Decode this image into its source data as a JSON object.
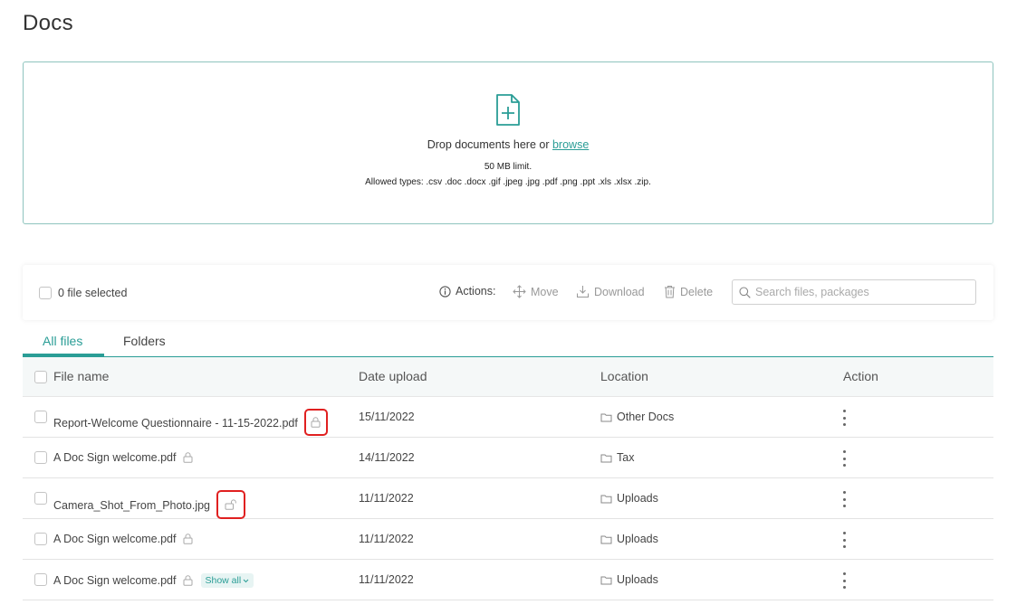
{
  "page": {
    "title": "Docs"
  },
  "dropzone": {
    "text": "Drop documents here or",
    "browse_label": "browse",
    "limit": "50 MB limit.",
    "allowed": "Allowed types: .csv .doc .docx .gif .jpeg .jpg .pdf .png .ppt .xls .xlsx .zip.",
    "icon": "file-add-icon"
  },
  "toolbar": {
    "selected_label": "0 file selected",
    "actions_label": "Actions:",
    "move_label": "Move",
    "download_label": "Download",
    "delete_label": "Delete",
    "search_placeholder": "Search files, packages"
  },
  "tabs": [
    {
      "label": "All files",
      "active": true
    },
    {
      "label": "Folders",
      "active": false
    }
  ],
  "table": {
    "headers": {
      "name": "File name",
      "date": "Date upload",
      "location": "Location",
      "action": "Action"
    },
    "rows": [
      {
        "name": "Report-Welcome Questionnaire - 11-15-2022.pdf",
        "date": "15/11/2022",
        "location": "Other Docs",
        "lock": "locked-highlighted"
      },
      {
        "name": "A Doc Sign welcome.pdf",
        "date": "14/11/2022",
        "location": "Tax",
        "lock": "locked"
      },
      {
        "name": "Camera_Shot_From_Photo.jpg",
        "date": "11/11/2022",
        "location": "Uploads",
        "lock": "unlocked-highlighted"
      },
      {
        "name": "A Doc Sign welcome.pdf",
        "date": "11/11/2022",
        "location": "Uploads",
        "lock": "locked"
      },
      {
        "name": "A Doc Sign welcome.pdf",
        "date": "11/11/2022",
        "location": "Uploads",
        "lock": "locked",
        "show_all_label": "Show all"
      }
    ]
  },
  "colors": {
    "accent": "#2a9d96",
    "highlight": "#e02020",
    "dropzone_border": "#8ec4be"
  }
}
